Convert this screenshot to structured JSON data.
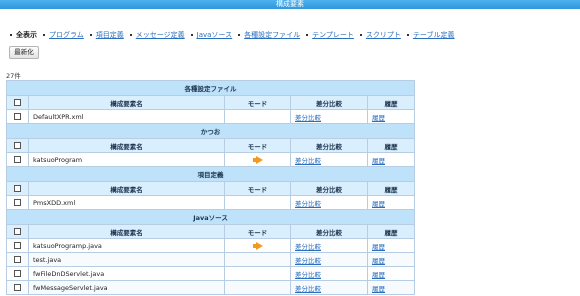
{
  "window": {
    "title": "構成要素"
  },
  "tabs": [
    {
      "label": "全表示",
      "active": true
    },
    {
      "label": "プログラム"
    },
    {
      "label": "項目定義"
    },
    {
      "label": "メッセージ定義"
    },
    {
      "label": "Javaソース"
    },
    {
      "label": "各種設定ファイル"
    },
    {
      "label": "テンプレート"
    },
    {
      "label": "スクリプト"
    },
    {
      "label": "テーブル定義"
    }
  ],
  "toolbar": {
    "refresh_label": "最新化"
  },
  "summary": {
    "count": "27件"
  },
  "columns": {
    "name": "構成要素名",
    "mode": "モード",
    "diff": "差分比較",
    "history": "履歴"
  },
  "sections": [
    {
      "title": "各種設定ファイル",
      "rows": [
        {
          "name": "DefaultXPR.xml",
          "mode_arrow": false,
          "diff": "差分比較",
          "history": "履歴"
        }
      ]
    },
    {
      "title": "かつお",
      "rows": [
        {
          "name": "katsuoProgram",
          "mode_arrow": true,
          "diff": "差分比較",
          "history": "履歴"
        }
      ]
    },
    {
      "title": "項目定義",
      "rows": [
        {
          "name": "PmsXDD.xml",
          "mode_arrow": false,
          "diff": "差分比較",
          "history": "履歴"
        }
      ]
    },
    {
      "title": "Javaソース",
      "rows": [
        {
          "name": "katsuoProgramp.java",
          "mode_arrow": true,
          "diff": "差分比較",
          "history": "履歴"
        },
        {
          "name": "test.java",
          "mode_arrow": false,
          "diff": "差分比較",
          "history": "履歴"
        },
        {
          "name": "fwFileDnDServlet.java",
          "mode_arrow": false,
          "diff": "差分比較",
          "history": "履歴"
        },
        {
          "name": "fwMessageServlet.java",
          "mode_arrow": false,
          "diff": "差分比較",
          "history": "履歴"
        }
      ]
    }
  ],
  "colors": {
    "titlebar": "#2f97dc",
    "section_bg": "#bfe2fb",
    "header_bg": "#daeffd",
    "link": "#2a6fbd",
    "mode_arrow": "#f39a1e"
  }
}
